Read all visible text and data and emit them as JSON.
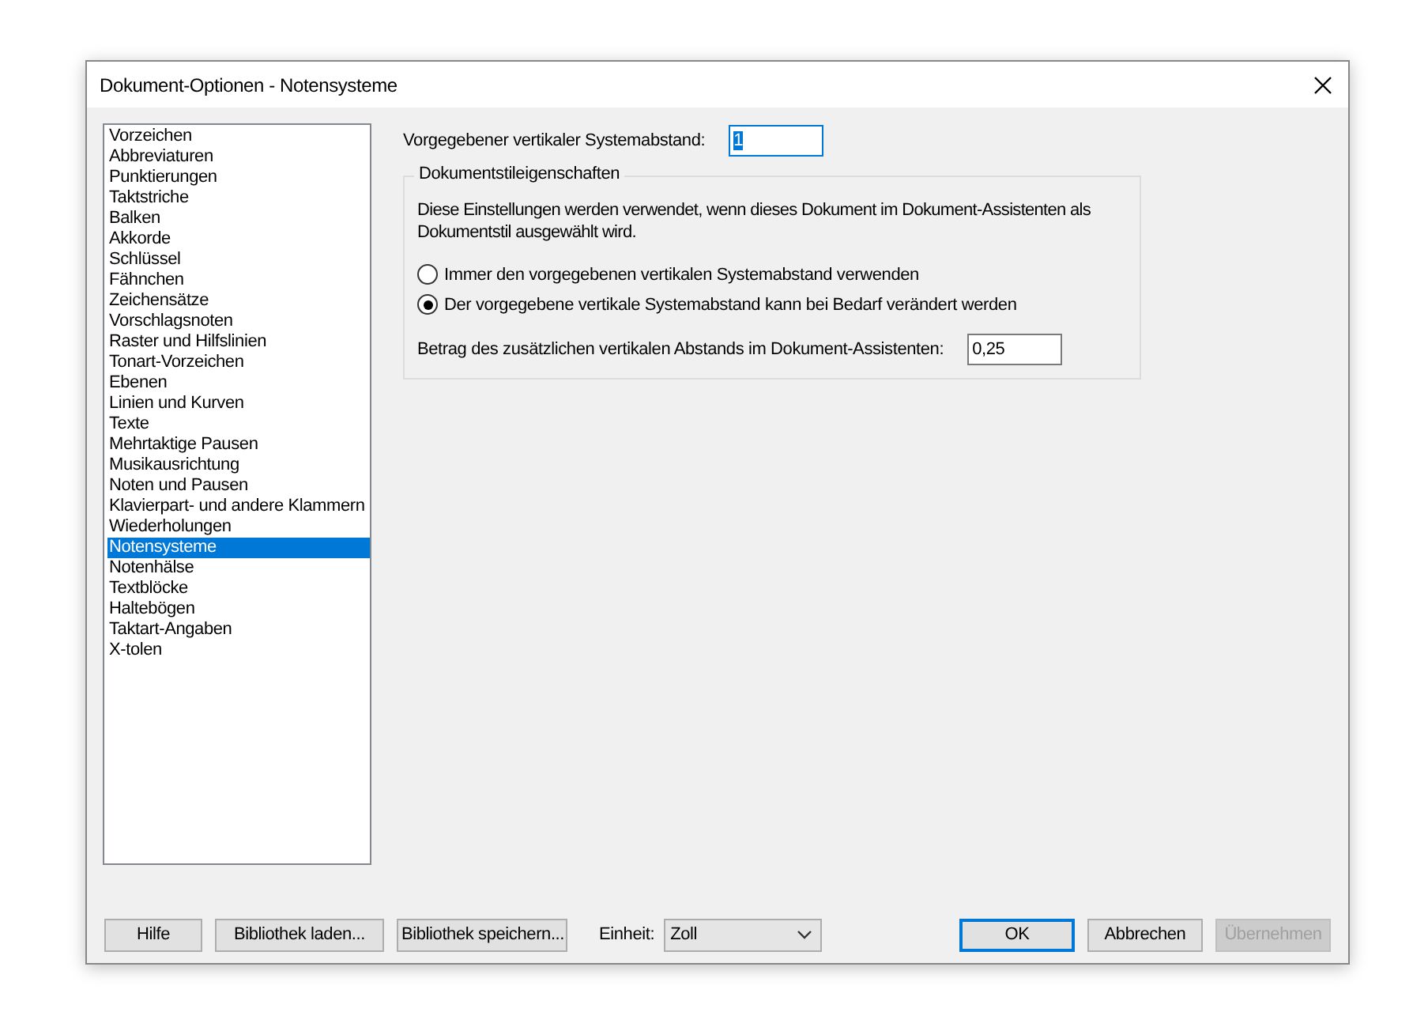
{
  "window": {
    "title": "Dokument-Optionen - Notensysteme"
  },
  "sidebar": {
    "items": [
      {
        "label": "Vorzeichen",
        "selected": false
      },
      {
        "label": "Abbreviaturen",
        "selected": false
      },
      {
        "label": "Punktierungen",
        "selected": false
      },
      {
        "label": "Taktstriche",
        "selected": false
      },
      {
        "label": "Balken",
        "selected": false
      },
      {
        "label": "Akkorde",
        "selected": false
      },
      {
        "label": "Schlüssel",
        "selected": false
      },
      {
        "label": "Fähnchen",
        "selected": false
      },
      {
        "label": "Zeichensätze",
        "selected": false
      },
      {
        "label": "Vorschlagsnoten",
        "selected": false
      },
      {
        "label": "Raster und Hilfslinien",
        "selected": false
      },
      {
        "label": "Tonart-Vorzeichen",
        "selected": false
      },
      {
        "label": "Ebenen",
        "selected": false
      },
      {
        "label": "Linien und Kurven",
        "selected": false
      },
      {
        "label": "Texte",
        "selected": false
      },
      {
        "label": "Mehrtaktige Pausen",
        "selected": false
      },
      {
        "label": "Musikausrichtung",
        "selected": false
      },
      {
        "label": "Noten und Pausen",
        "selected": false
      },
      {
        "label": "Klavierpart- und andere Klammern",
        "selected": false
      },
      {
        "label": "Wiederholungen",
        "selected": false
      },
      {
        "label": "Notensysteme",
        "selected": true
      },
      {
        "label": "Notenhälse",
        "selected": false
      },
      {
        "label": "Textblöcke",
        "selected": false
      },
      {
        "label": "Haltebögen",
        "selected": false
      },
      {
        "label": "Taktart-Angaben",
        "selected": false
      },
      {
        "label": "X-tolen",
        "selected": false
      }
    ]
  },
  "spacing": {
    "label": "Vorgegebener vertikaler Systemabstand:",
    "value": "1"
  },
  "group": {
    "title": "Dokumentstileigenschaften",
    "description": "Diese Einstellungen werden verwendet, wenn dieses Dokument im Dokument-Assistenten als Dokumentstil ausgewählt wird.",
    "options": [
      {
        "label": "Immer den vorgegebenen vertikalen Systemabstand verwenden",
        "selected": false
      },
      {
        "label": "Der vorgegebene vertikale Systemabstand kann bei Bedarf verändert werden",
        "selected": true
      }
    ],
    "extra": {
      "label": "Betrag des zusätzlichen vertikalen Abstands im Dokument-Assistenten:",
      "value": "0,25"
    }
  },
  "footer": {
    "left_buttons": [
      "Hilfe",
      "Bibliothek laden...",
      "Bibliothek speichern..."
    ],
    "unit": {
      "label": "Einheit:",
      "value": "Zoll"
    },
    "right_buttons": [
      {
        "label": "OK",
        "kind": "default",
        "disabled": false
      },
      {
        "label": "Abbrechen",
        "kind": "normal",
        "disabled": false
      },
      {
        "label": "Übernehmen",
        "kind": "normal",
        "disabled": true
      }
    ]
  }
}
